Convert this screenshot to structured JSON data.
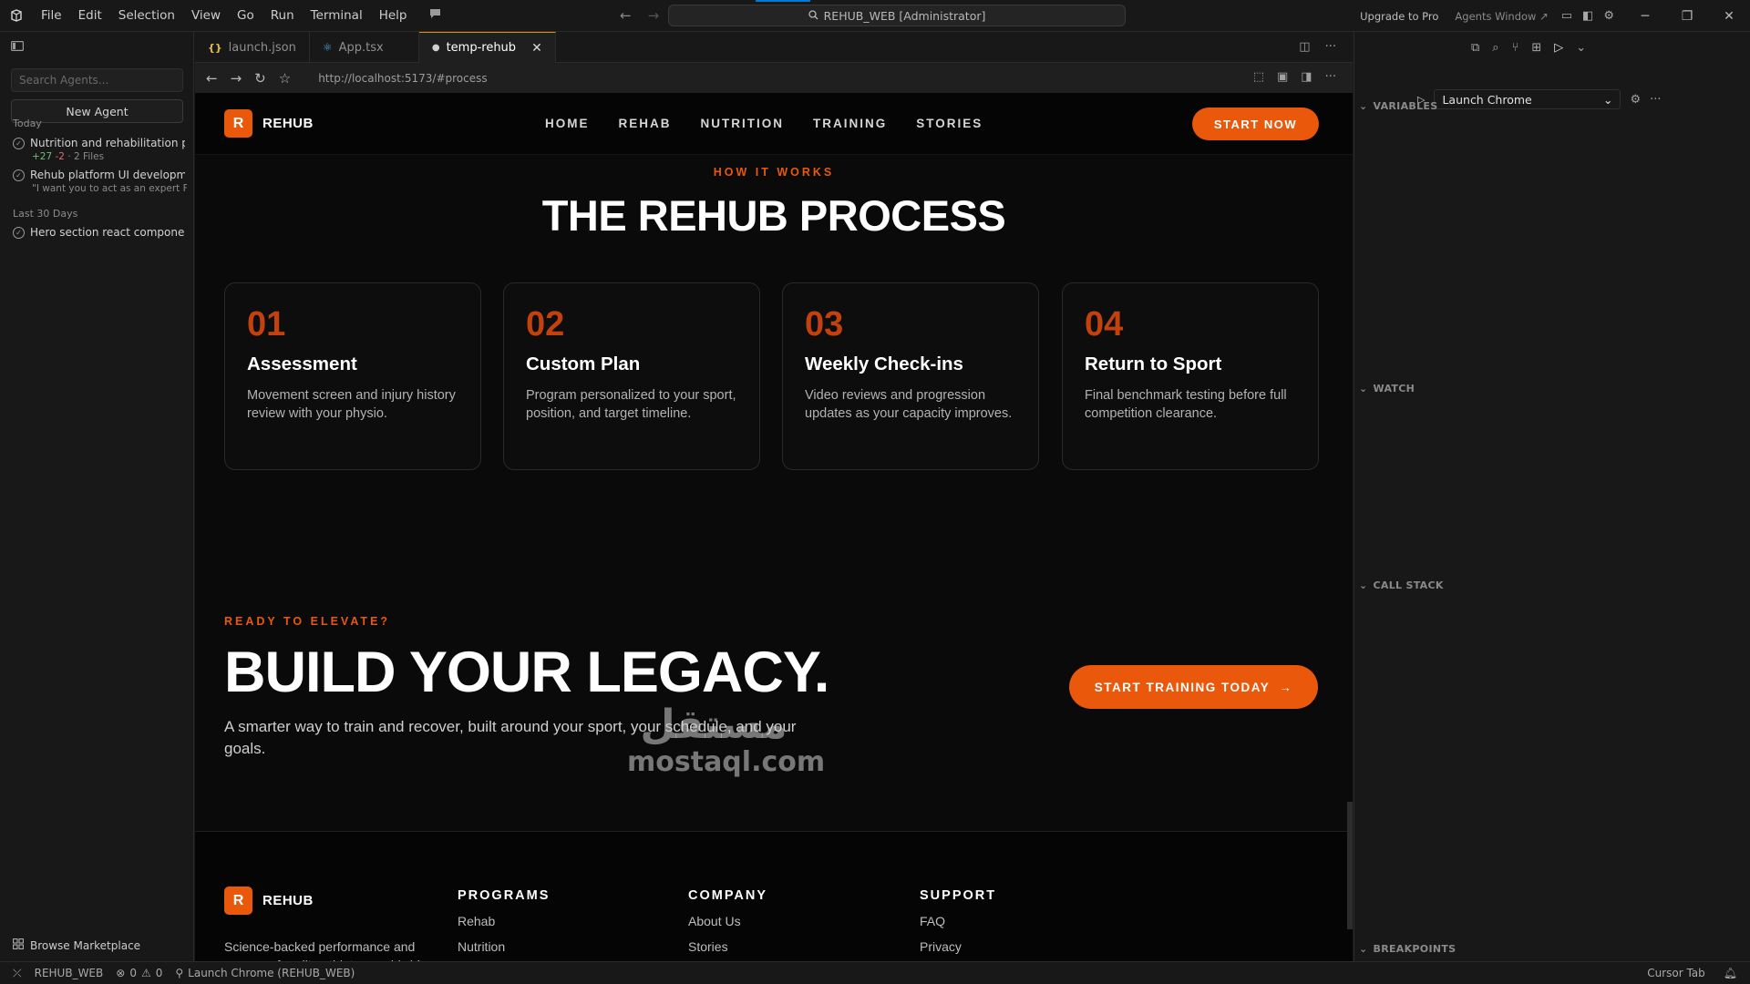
{
  "titlebar": {
    "menu": [
      "File",
      "Edit",
      "Selection",
      "View",
      "Go",
      "Run",
      "Terminal",
      "Help"
    ],
    "search_text": "REHUB_WEB [Administrator]",
    "upgrade": "Upgrade to Pro",
    "agents_window": "Agents Window ↗"
  },
  "agents": {
    "search_placeholder": "Search Agents...",
    "new_agent": "New Agent",
    "today_label": "Today",
    "last30_label": "Last 30 Days",
    "items": [
      {
        "title": "Nutrition and rehabilitation pl",
        "added": "+27",
        "removed": "-2",
        "files": "· 2 Files"
      },
      {
        "title": "Rehub platform UI developme",
        "sub": "\"I want you to act as an expert Fu"
      },
      {
        "title": "Hero section react component"
      }
    ],
    "marketplace": "Browse Marketplace"
  },
  "tabs": [
    {
      "label": "launch.json",
      "icon": "json-icon"
    },
    {
      "label": "App.tsx",
      "icon": "tsx-icon"
    },
    {
      "label": "temp-rehub",
      "icon": "globe-icon"
    }
  ],
  "browser": {
    "url": "http://localhost:5173/#process"
  },
  "site": {
    "brand": "REHUB",
    "brand_mark": "R",
    "nav": [
      "HOME",
      "REHAB",
      "NUTRITION",
      "TRAINING",
      "STORIES"
    ],
    "start_now": "START NOW",
    "eyebrow": "HOW IT WORKS",
    "title": "THE REHUB PROCESS",
    "steps": [
      {
        "num": "01",
        "title": "Assessment",
        "desc": "Movement screen and injury history review with your physio."
      },
      {
        "num": "02",
        "title": "Custom Plan",
        "desc": "Program personalized to your sport, position, and target timeline."
      },
      {
        "num": "03",
        "title": "Weekly Check-ins",
        "desc": "Video reviews and progression updates as your capacity improves."
      },
      {
        "num": "04",
        "title": "Return to Sport",
        "desc": "Final benchmark testing before full competition clearance."
      }
    ],
    "cta_eyebrow": "READY TO ELEVATE?",
    "cta_title": "BUILD YOUR LEGACY.",
    "cta_sub": "A smarter way to train and recover, built around your sport, your schedule, and your goals.",
    "cta_button": "START TRAINING TODAY",
    "footer": {
      "desc": "Science-backed performance and recovery for elite athletes worldwide.",
      "programs": {
        "heading": "PROGRAMS",
        "links": [
          "Rehab",
          "Nutrition"
        ]
      },
      "company": {
        "heading": "COMPANY",
        "links": [
          "About Us",
          "Stories"
        ]
      },
      "support": {
        "heading": "SUPPORT",
        "links": [
          "FAQ",
          "Privacy"
        ]
      }
    }
  },
  "watermark": {
    "arabic": "مستقل",
    "latin": "mostaql.com"
  },
  "debug": {
    "launch_config": "Launch Chrome",
    "sections": [
      "VARIABLES",
      "WATCH",
      "CALL STACK",
      "BREAKPOINTS"
    ]
  },
  "statusbar": {
    "workspace": "REHUB_WEB",
    "errors": "0",
    "warnings": "0",
    "launch": "Launch Chrome (REHUB_WEB)",
    "cursor_tab": "Cursor Tab"
  },
  "colors": {
    "accent": "#ea580c",
    "step_number": "#c2410c",
    "vscode_bg": "#181818",
    "site_bg": "#0a0a0a"
  }
}
